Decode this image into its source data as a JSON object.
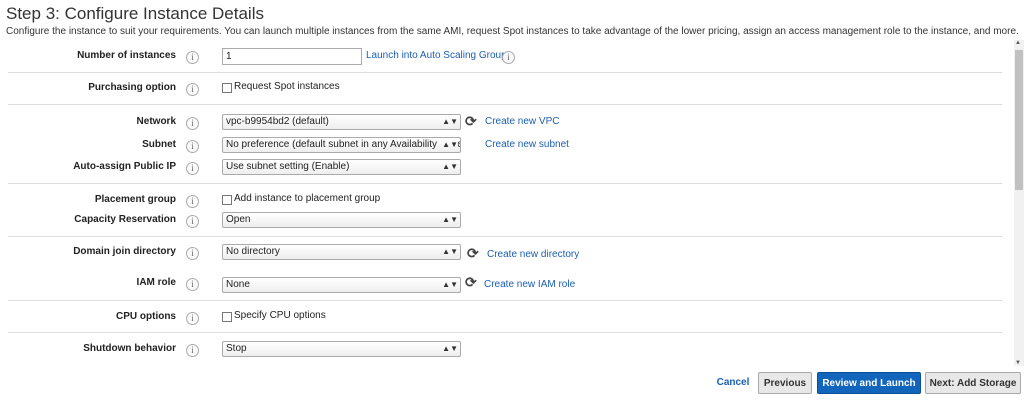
{
  "page": {
    "title": "Step 3: Configure Instance Details",
    "description": "Configure the instance to suit your requirements. You can launch multiple instances from the same AMI, request Spot instances to take advantage of the lower pricing, assign an access management role to the instance, and more."
  },
  "info_glyph": "i",
  "fields": {
    "num_instances": {
      "label": "Number of instances",
      "value": "1",
      "link": "Launch into Auto Scaling Group"
    },
    "purchasing": {
      "label": "Purchasing option",
      "checkbox": "Request Spot instances"
    },
    "network": {
      "label": "Network",
      "value": "vpc-b9954bd2 (default)",
      "link": "Create new VPC"
    },
    "subnet": {
      "label": "Subnet",
      "value": "No preference (default subnet in any Availability Zone)",
      "link": "Create new subnet"
    },
    "public_ip": {
      "label": "Auto-assign Public IP",
      "value": "Use subnet setting (Enable)"
    },
    "placement": {
      "label": "Placement group",
      "checkbox": "Add instance to placement group"
    },
    "capacity": {
      "label": "Capacity Reservation",
      "value": "Open"
    },
    "domain": {
      "label": "Domain join directory",
      "value": "No directory",
      "link": "Create new directory"
    },
    "iam": {
      "label": "IAM role",
      "value": "None",
      "link": "Create new IAM role"
    },
    "cpu": {
      "label": "CPU options",
      "checkbox": "Specify CPU options"
    },
    "shutdown": {
      "label": "Shutdown behavior",
      "value": "Stop"
    }
  },
  "footer": {
    "cancel": "Cancel",
    "previous": "Previous",
    "review": "Review and Launch",
    "next": "Next: Add Storage"
  },
  "colors": {
    "link": "#1a5fb4",
    "primary_button": "#1166bb"
  }
}
